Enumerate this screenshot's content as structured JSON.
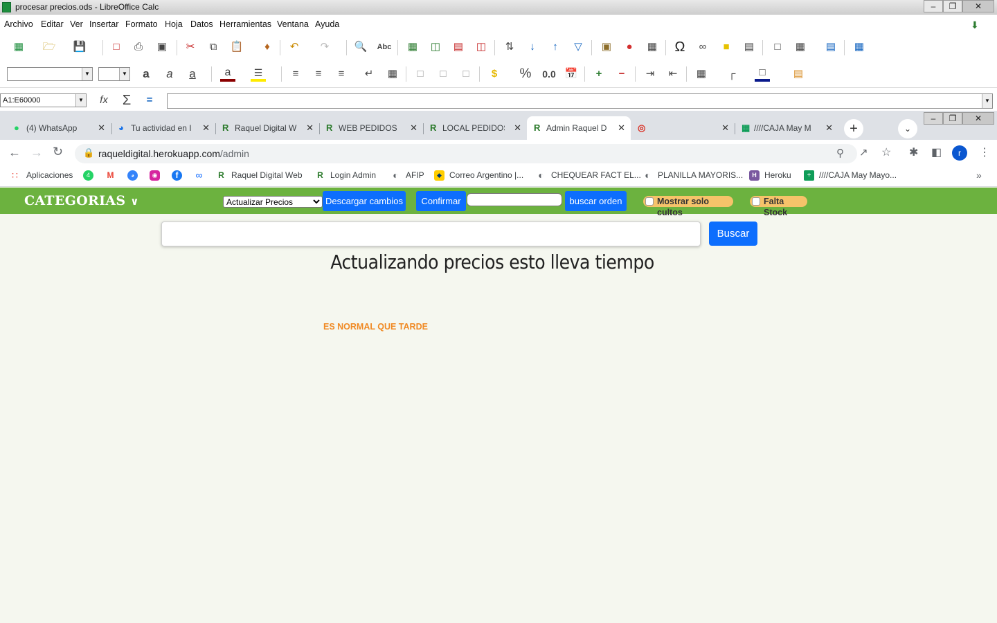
{
  "lo": {
    "title": "procesar precios.ods - LibreOffice Calc",
    "menu": [
      "Archivo",
      "Editar",
      "Ver",
      "Insertar",
      "Formato",
      "Hoja",
      "Datos",
      "Herramientas",
      "Ventana",
      "Ayuda"
    ],
    "name_box": "A1:E60000",
    "number_format_label": "0.0",
    "percent_label": "%"
  },
  "chrome": {
    "tabs": [
      {
        "label": "(4) WhatsApp",
        "icon": "whatsapp-icon"
      },
      {
        "label": "Tu actividad en I",
        "icon": "mercadolibre-icon"
      },
      {
        "label": "Raquel Digital W",
        "icon": "raquel-icon"
      },
      {
        "label": "WEB PEDIDOS",
        "icon": "raquel-icon"
      },
      {
        "label": "LOCAL PEDIDOS",
        "icon": "raquel-icon"
      },
      {
        "label": "Admin Raquel D",
        "icon": "raquel-icon"
      },
      {
        "label": "",
        "icon": "blocked-icon"
      },
      {
        "label": "////CAJA May M",
        "icon": "sheets-icon"
      }
    ],
    "url_domain": "raqueldigital.herokuapp.com",
    "url_path": "/admin",
    "profile_initial": "r",
    "bookmarks": [
      {
        "label": "Aplicaciones",
        "icon": "apps-icon"
      },
      {
        "label": "Raquel Digital Web",
        "icon": "raquel-icon"
      },
      {
        "label": "Login Admin",
        "icon": "raquel-icon"
      },
      {
        "label": "AFIP",
        "icon": "globe-icon"
      },
      {
        "label": "Correo Argentino |...",
        "icon": "correo-icon"
      },
      {
        "label": "CHEQUEAR FACT EL...",
        "icon": "globe-icon"
      },
      {
        "label": "PLANILLA MAYORIS...",
        "icon": "globe-icon"
      },
      {
        "label": "Heroku",
        "icon": "heroku-icon"
      },
      {
        "label": "////CAJA May Mayo...",
        "icon": "sheets-icon"
      }
    ]
  },
  "app": {
    "brand": "CATEGORIAS",
    "action_select": "Actualizar Precios",
    "download_button": "Descargar cambios",
    "confirm_button": "Confirmar",
    "order_search_value": "",
    "order_search_button": "buscar orden",
    "only_cultos_label": "Mostrar solo cultos",
    "no_stock_label": "Falta Stock",
    "search_value": "",
    "search_button": "Buscar",
    "heading": "Actualizando precios esto lleva tiempo",
    "note": "ES NORMAL QUE TARDE",
    "colors": {
      "navbar": "#6cb23f",
      "button": "#0d6efd",
      "note": "#f08a24",
      "background": "#f5f7ef"
    }
  }
}
